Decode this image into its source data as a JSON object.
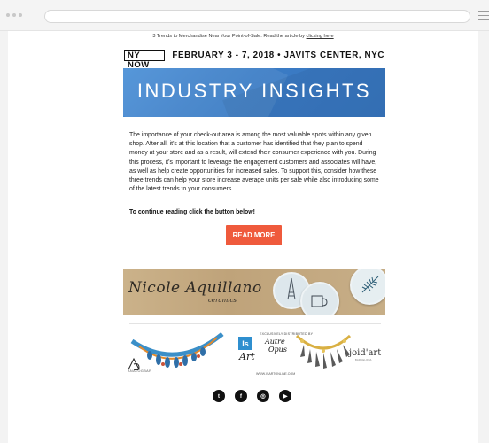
{
  "browser": {
    "url": ""
  },
  "email": {
    "preheader_text": "3 Trends to Merchandise Near Your Point-of-Sale. Read the article by ",
    "preheader_link": "clicking here",
    "brand_logo": "NY NOW",
    "event_line": "FEBRUARY 3 - 7, 2018 • JAVITS CENTER, NYC",
    "hero_title": "INDUSTRY INSIGHTS",
    "body_paragraph": "The importance of your check-out area is among the most valuable spots within any given shop. After all, it’s at this location that a customer has identified that they plan to spend money at your store and as a result, will extend their consumer experience with you. During this process, it’s important to leverage the engagement customers and associates will have, as well as help create opportunities for increased sales. To support this, consider how these three trends can help your store increase average units per sale while also introducing some of the latest trends to your consumers.",
    "cta_lead": "To continue reading click the button below!",
    "cta_button": "READ MORE",
    "banner_brand": "Nicole Aquillano",
    "banner_sub": "ceramics",
    "sponsors": {
      "abbr_label": "ANALOGBAR",
      "dist_label": "EXCLUSIVELY DISTRIBUTED BY",
      "dist_url": "WWW.ISARTONLINE.COM",
      "is_mark": "Is",
      "art_mark": "Art",
      "autre_mark": "Autre",
      "opus_mark": "Opus",
      "joid_mark": "joid'art",
      "joid_sub": "BARCELONA"
    },
    "social": [
      {
        "icon": "twitter-icon",
        "glyph": "t"
      },
      {
        "icon": "facebook-icon",
        "glyph": "f"
      },
      {
        "icon": "instagram-icon",
        "glyph": "◎"
      },
      {
        "icon": "youtube-icon",
        "glyph": "▶"
      }
    ]
  },
  "colors": {
    "hero_blue": "#3b7cc5",
    "cta_orange": "#ef5a3c"
  }
}
